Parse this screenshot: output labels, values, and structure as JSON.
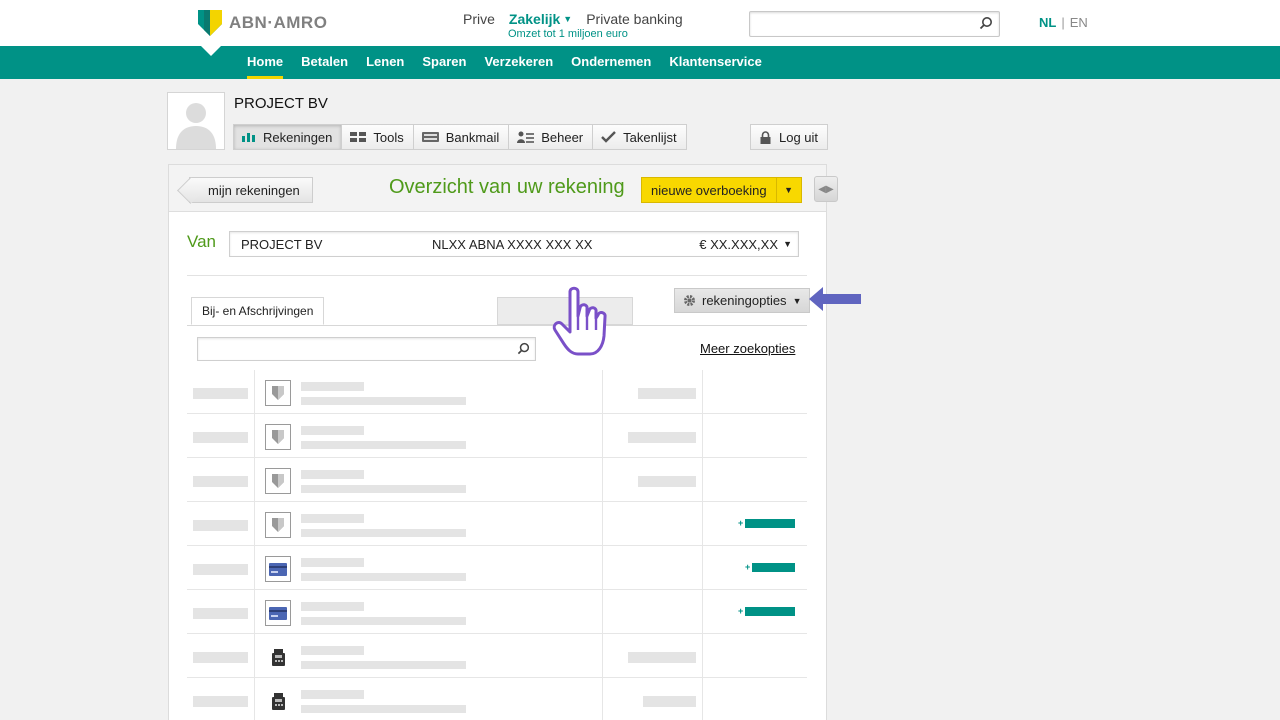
{
  "brand": {
    "name": "ABN·AMRO"
  },
  "segments": {
    "prive": "Prive",
    "zakelijk": "Zakelijk",
    "private_banking": "Private banking",
    "subtitle": "Omzet tot 1 miljoen euro"
  },
  "language": {
    "nl": "NL",
    "separator": "|",
    "en": "EN"
  },
  "nav": [
    "Home",
    "Betalen",
    "Lenen",
    "Sparen",
    "Verzekeren",
    "Ondernemen",
    "Klantenservice"
  ],
  "account": {
    "company": "PROJECT BV"
  },
  "toolbar": {
    "rekeningen": "Rekeningen",
    "tools": "Tools",
    "bankmail": "Bankmail",
    "beheer": "Beheer",
    "takenlijst": "Takenlijst",
    "logout": "Log uit"
  },
  "panel": {
    "back": "mijn rekeningen",
    "title": "Overzicht van uw rekening",
    "new_transfer": "nieuwe overboeking",
    "from_label": "Van",
    "from_account": {
      "name": "PROJECT BV",
      "iban": "NLXX ABNA XXXX XXX XX",
      "balance": "€ XX.XXX,XX"
    },
    "tab_transactions": "Bij- en Afschrijvingen",
    "account_options": "rekeningopties",
    "more_search": "Meer zoekopties"
  },
  "colors": {
    "brand_green": "#009286",
    "accent_yellow": "#f8d800",
    "title_green": "#4f9a1a",
    "annotation_blue": "#6065c0"
  },
  "transactions": [
    {
      "icon": "shield-icon",
      "amount_type": "debit"
    },
    {
      "icon": "shield-icon",
      "amount_type": "debit"
    },
    {
      "icon": "shield-icon",
      "amount_type": "debit"
    },
    {
      "icon": "shield-icon",
      "amount_type": "credit"
    },
    {
      "icon": "card-icon",
      "amount_type": "credit"
    },
    {
      "icon": "card-icon",
      "amount_type": "credit"
    },
    {
      "icon": "pos-terminal-icon",
      "amount_type": "debit"
    },
    {
      "icon": "pos-terminal-icon",
      "amount_type": "debit"
    }
  ]
}
